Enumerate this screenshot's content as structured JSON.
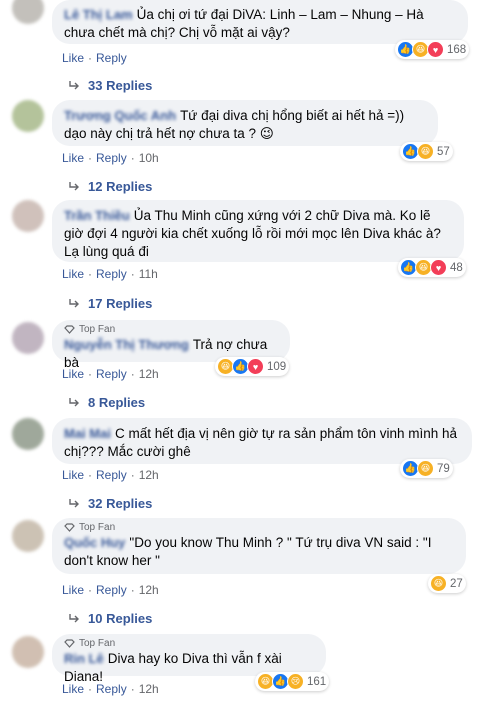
{
  "actions": {
    "like": "Like",
    "reply": "Reply",
    "separator": "·"
  },
  "comments": [
    {
      "author": "Lê Thị Lam",
      "top_fan": "",
      "text": "Ủa chị ơi tứ đại DiVA: Linh – Lam – Nhung – Hà chưa chết mà chị? Chị vỗ mặt ai vậy?",
      "time": "",
      "reaction_count": "168",
      "reactions": [
        "like",
        "haha",
        "love"
      ],
      "replies": "33 Replies"
    },
    {
      "author": "Trương Quốc Anh",
      "top_fan": "",
      "text": "Tứ đại diva chị hổng biết ai hết hả =)) dạo này chị trả hết nợ chưa ta ? 😉",
      "time": "10h",
      "reaction_count": "57",
      "reactions": [
        "like",
        "haha"
      ],
      "replies": "12 Replies"
    },
    {
      "author": "Trần Thiều",
      "top_fan": "",
      "text": "Ủa Thu Minh cũng xứng với 2 chữ Diva mà. Ko lẽ giờ đợi 4 người kia chết xuống lỗ rồi mới mọc lên Diva khác à? Lạ lùng quá đi",
      "time": "11h",
      "reaction_count": "48",
      "reactions": [
        "like",
        "haha",
        "love"
      ],
      "replies": "17 Replies"
    },
    {
      "author": "Nguyễn Thị Thương",
      "top_fan": "Top Fan",
      "text": "Trả nợ chưa bà",
      "time": "12h",
      "reaction_count": "109",
      "reactions": [
        "haha",
        "like",
        "love"
      ],
      "replies": "8 Replies"
    },
    {
      "author": "Mai Mai",
      "top_fan": "",
      "text": "C mất hết địa vị nên giờ tự ra sản phẩm tôn vinh mình hả chị??? Mắc cười ghê",
      "time": "12h",
      "reaction_count": "79",
      "reactions": [
        "like",
        "haha"
      ],
      "replies": "32 Replies"
    },
    {
      "author": "Quốc Huy",
      "top_fan": "Top Fan",
      "text": "\"Do you know Thu Minh ? \" Tứ trụ diva VN said : \"I don't know her \"",
      "time": "12h",
      "reaction_count": "27",
      "reactions": [
        "haha"
      ],
      "replies": "10 Replies"
    },
    {
      "author": "Rin Lê",
      "top_fan": "Top Fan",
      "text": "Diva hay ko Diva thì vẫn f xài Diana!",
      "time": "12h",
      "reaction_count": "161",
      "reactions": [
        "haha",
        "like",
        "sad"
      ],
      "replies": ""
    }
  ],
  "colors": {
    "bubble": "#f0f2f5",
    "link": "#385898",
    "muted": "#65676b",
    "like": "#1877f2",
    "haha": "#f7b125",
    "love": "#f33e58"
  }
}
